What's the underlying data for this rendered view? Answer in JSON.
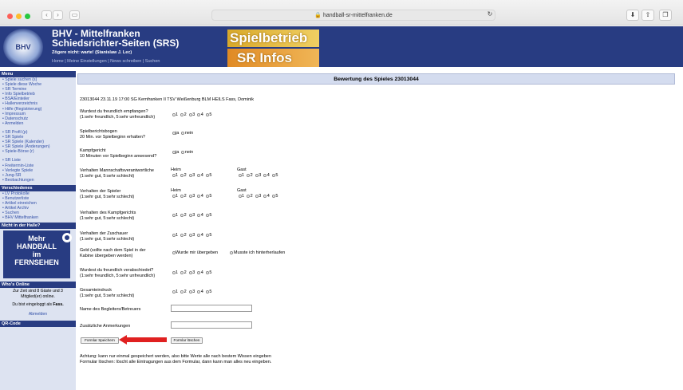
{
  "browser": {
    "url": "handball-sr-mittelfranken.de"
  },
  "header": {
    "title1": "BHV - Mittelfranken",
    "title2": "Schiedsrichter-Seiten (SRS)",
    "quote": "Zögere nicht: warte! (Stanislaw J. Lec)",
    "nav": "Home | Meine Einstellungen | News schreiben | Suchen",
    "logo_text": "BHV",
    "badge1": "Spielbetrieb",
    "badge2": "SR Infos"
  },
  "sidebar": {
    "menu_title": "Menu",
    "menu": [
      "Spiele suchen (s)",
      "Spiele diese Woche",
      "SR Termine",
      "Info Spielbetrieb",
      "BSA/Einteiler",
      "Hallenverzeichnis",
      "Hilfe (Registrierung)",
      "Impressum",
      "Datenschutz",
      "Anmelden"
    ],
    "menu2": [
      "SR Profil (p)",
      "SR Spiele",
      "SR Spiele (Kalender)",
      "SR Spiele (Änderungen)",
      "Spiele-Börse (r)"
    ],
    "menu3": [
      "SR Liste",
      "Freitermin-Liste",
      "Verlegte Spiele",
      "Jung-SR",
      "Beobachtungen"
    ],
    "misc_title": "Verschiedenes",
    "misc": [
      "LV Protokolle",
      "Benutzerliste",
      "Artikel einreichen",
      "Artikel Archiv",
      "Suchen",
      "BHV Mittelfranken"
    ],
    "halle_title": "Nicht in der Halle?",
    "ad": [
      "Mehr",
      "HANDBALL",
      "im",
      "FERNSEHEN"
    ],
    "online_title": "Who's Online",
    "online_text": "Zur Zeit sind 8 Gäste und 3 Mitglied(er) online.",
    "login_prefix": "Du bist eingeloggt als ",
    "login_user": "Fass.",
    "logout": "Abmelden",
    "qr_title": "QR-Code"
  },
  "main": {
    "title": "Bewertung des Spieles 23013044",
    "game": "23013044 23.11.19 17:00 SG Kernfranken II TSV Weißenburg BLM HEILS Fass, Dominik",
    "q1": [
      "Wurdest du freundlich empfangen?",
      "(1:sehr freundlich, 5:sehr unfreundlich)"
    ],
    "q2": [
      "Spielberichtsbogen",
      "20 Min. vor Spielbeginn erhalten?"
    ],
    "q3": [
      "Kampfgericht",
      "10 Minuten vor Spielbeginn anwesend?"
    ],
    "q4": [
      "Verhalten Mannschaftsverantwortliche",
      "(1:sehr gut, 5:sehr schlecht)"
    ],
    "q5": [
      "Verhalten der Spieler",
      "(1:sehr gut, 5:sehr schlecht)"
    ],
    "q6": [
      "Verhalten des Kampfgerichts",
      "(1:sehr gut, 5:sehr schlecht)"
    ],
    "q7": [
      "Verhalten der Zuschauer",
      "(1:sehr gut, 5:sehr schlecht)"
    ],
    "q8": [
      "Geld (sollte nach dem Spiel in der",
      "Kabine übergeben werden)"
    ],
    "q9": [
      "Wurdest du freundlich verabschiedet?",
      "(1:sehr freundlich, 5:sehr unfreundlich)"
    ],
    "q10": [
      "Gesamteindruck",
      "(1:sehr gut, 5:sehr schlecht)"
    ],
    "heim": "Heim",
    "gast": "Gast",
    "ja": "ja",
    "nein": "nein",
    "geld_a": "Wurde mir übergeben",
    "geld_b": "Musste ich hinterherlaufen",
    "begleiter": "Name des Begleiters/Betreuers",
    "anmerkungen": "Zusätzliche Anmerkungen",
    "save": "Formlar Speichern",
    "clear": "Formlar löschen",
    "note1": "Achtung: kann nur einmal gespeichert werden, also bitte Werte alle nach bestem Wissen eingeben",
    "note2": "Formular löschen: löscht alle Eintragungen aus dem Formular, dann kann man alles neu eingeben."
  }
}
